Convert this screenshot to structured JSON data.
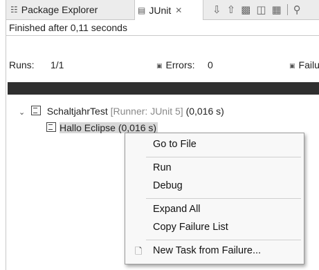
{
  "tabs": [
    {
      "label": "Package Explorer",
      "icon": "package-explorer-icon"
    },
    {
      "label": "JUnit",
      "icon": "junit-icon",
      "close": "✕"
    }
  ],
  "toolbar_icons": [
    "next-failure-icon",
    "previous-failure-icon",
    "relaunch-icon",
    "history-icon",
    "layout-icon",
    "search-icon"
  ],
  "status": "Finished after 0,11 seconds",
  "counters": {
    "runs_label": "Runs:",
    "runs_value": "1/1",
    "errors_label": "Errors:",
    "errors_value": "0",
    "failures_label": "Failu"
  },
  "progress": {
    "fraction": 1.0,
    "color": "#2f2f2f"
  },
  "tree": {
    "root": {
      "name": "SchaltjahrTest",
      "runner": "[Runner: JUnit 5]",
      "time": "(0,016 s)"
    },
    "child": {
      "name": "Hallo Eclipse (0,016 s)"
    }
  },
  "context_menu": {
    "items": [
      {
        "label": "Go to File"
      },
      {
        "label": "Run"
      },
      {
        "label": "Debug"
      },
      {
        "label": "Expand All"
      },
      {
        "label": "Copy Failure List"
      },
      {
        "label": "New Task from Failure...",
        "icon": "new-task-icon"
      }
    ]
  }
}
